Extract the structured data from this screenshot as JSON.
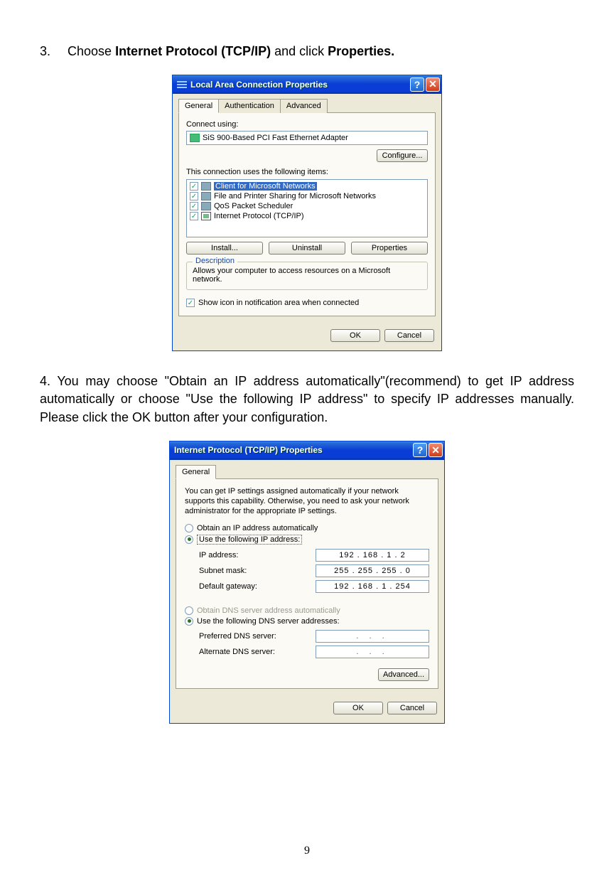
{
  "step3": {
    "number": "3.",
    "prefix": "Choose ",
    "bold1": "Internet Protocol (TCP/IP)",
    "mid": " and click ",
    "bold2": "Properties."
  },
  "dlg1": {
    "title": "Local Area Connection Properties",
    "tabs": [
      "General",
      "Authentication",
      "Advanced"
    ],
    "connect_using": "Connect using:",
    "adapter": "SiS 900-Based PCI Fast Ethernet Adapter",
    "configure": "Configure...",
    "uses_items": "This connection uses the following items:",
    "items": [
      "Client for Microsoft Networks",
      "File and Printer Sharing for Microsoft Networks",
      "QoS Packet Scheduler",
      "Internet Protocol (TCP/IP)"
    ],
    "install": "Install...",
    "uninstall": "Uninstall",
    "properties": "Properties",
    "description_label": "Description",
    "description_text": "Allows your computer to access resources on a Microsoft network.",
    "show_icon": "Show icon in notification area when connected",
    "ok": "OK",
    "cancel": "Cancel"
  },
  "step4": {
    "number": "4.",
    "text": "  You may choose \"Obtain an IP address automatically\"(recommend) to get IP address automatically or choose \"Use the following IP address\" to specify IP addresses manually. Please click the OK button after your configuration."
  },
  "dlg2": {
    "title": "Internet Protocol (TCP/IP) Properties",
    "tab": "General",
    "info": "You can get IP settings assigned automatically if your network supports this capability. Otherwise, you need to ask your network administrator for the appropriate IP settings.",
    "auto_ip": "Obtain an IP address automatically",
    "use_ip": "Use the following IP address:",
    "ip_label": "IP address:",
    "ip_value": "192 . 168 .   1  .   2",
    "subnet_label": "Subnet mask:",
    "subnet_value": "255 . 255 . 255 .   0",
    "gateway_label": "Default gateway:",
    "gateway_value": "192 . 168 .   1  . 254",
    "auto_dns": "Obtain DNS server address automatically",
    "use_dns": "Use the following DNS server addresses:",
    "pref_dns_label": "Preferred DNS server:",
    "pref_dns_value": ".       .       .",
    "alt_dns_label": "Alternate DNS server:",
    "alt_dns_value": ".       .       .",
    "advanced": "Advanced...",
    "ok": "OK",
    "cancel": "Cancel"
  },
  "page_number": "9"
}
